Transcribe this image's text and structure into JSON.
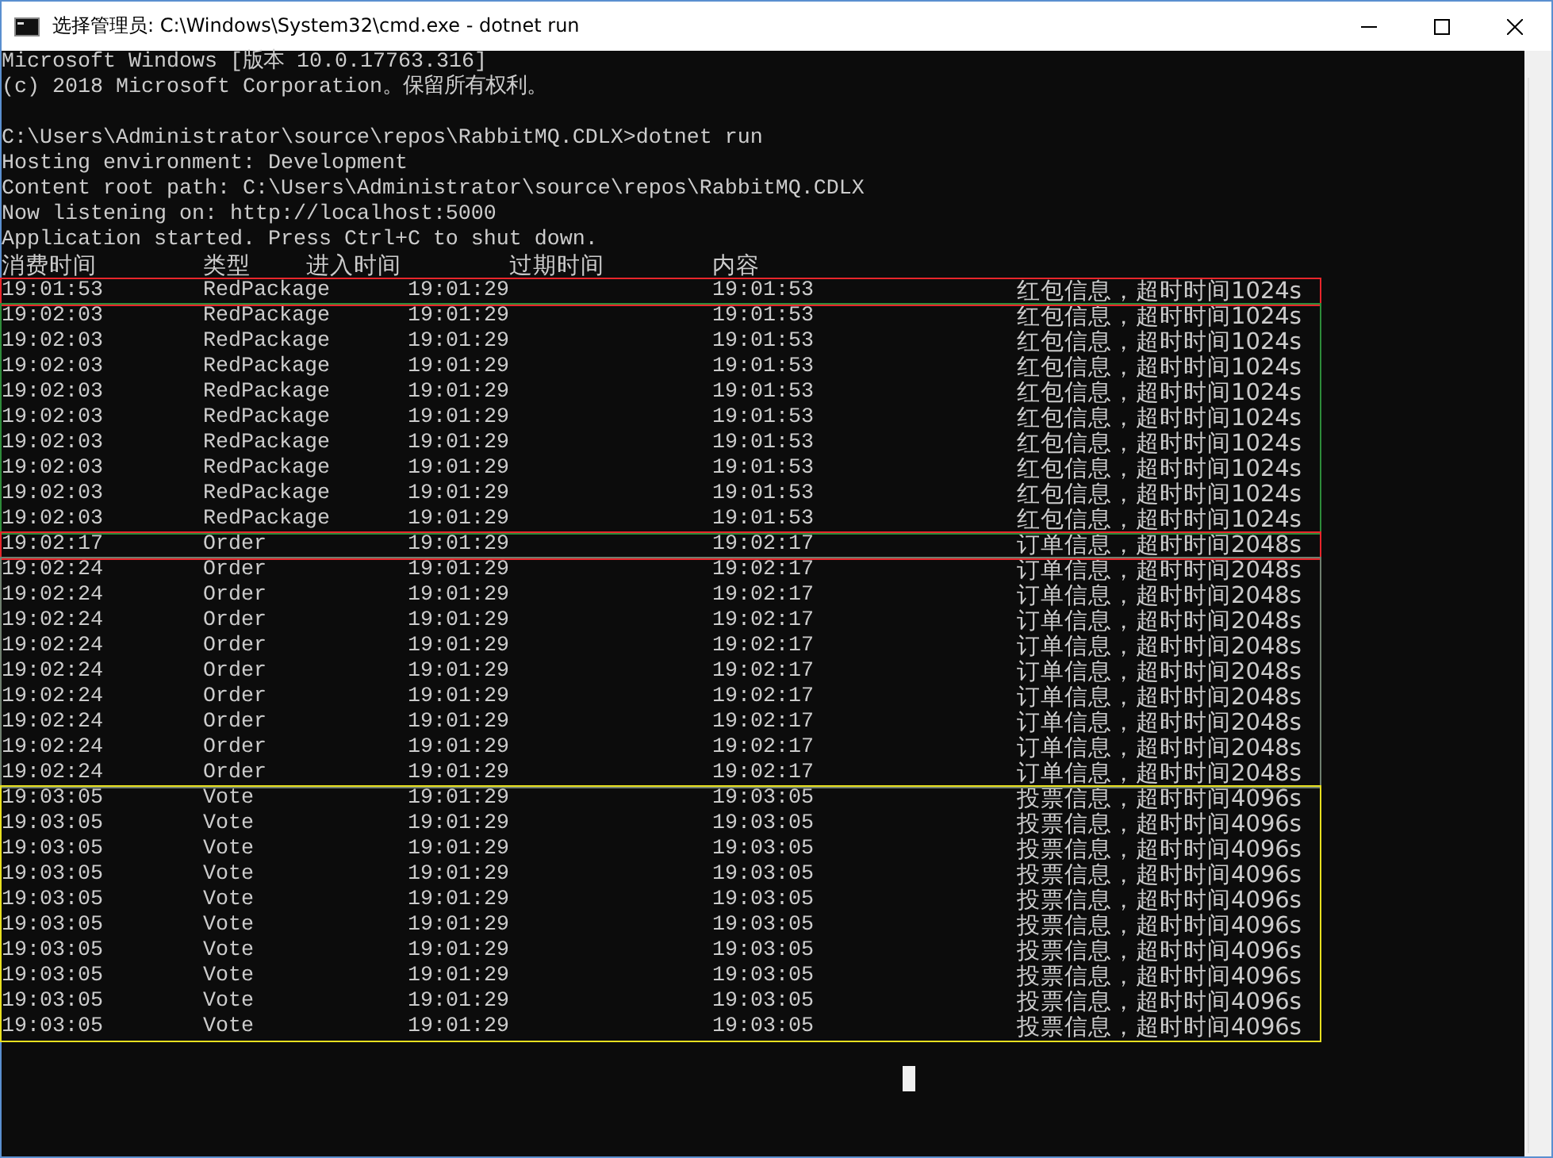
{
  "window": {
    "title": "选择管理员: C:\\Windows\\System32\\cmd.exe - dotnet  run"
  },
  "console": {
    "blocks": [
      [
        "Microsoft Windows [版本 10.0.17763.316]",
        "(c) 2018 Microsoft Corporation。保留所有权利。"
      ],
      [
        "C:\\Users\\Administrator\\source\\repos\\RabbitMQ.CDLX>dotnet run",
        "Hosting environment: Development",
        "Content root path: C:\\Users\\Administrator\\source\\repos\\RabbitMQ.CDLX",
        "Now listening on: http://localhost:5000",
        "Application started. Press Ctrl+C to shut down."
      ]
    ],
    "header": [
      "消费时间",
      "类型",
      "进入时间",
      "过期时间",
      "内容"
    ],
    "groups": [
      {
        "color": "#e8262b",
        "rows": [
          [
            "19:01:53",
            "RedPackage",
            "19:01:29",
            "19:01:53",
            "红包信息，超时时间1024s"
          ]
        ]
      },
      {
        "color": "#2e8b3a",
        "rows": [
          [
            "19:02:03",
            "RedPackage",
            "19:01:29",
            "19:01:53",
            "红包信息，超时时间1024s"
          ],
          [
            "19:02:03",
            "RedPackage",
            "19:01:29",
            "19:01:53",
            "红包信息，超时时间1024s"
          ],
          [
            "19:02:03",
            "RedPackage",
            "19:01:29",
            "19:01:53",
            "红包信息，超时时间1024s"
          ],
          [
            "19:02:03",
            "RedPackage",
            "19:01:29",
            "19:01:53",
            "红包信息，超时时间1024s"
          ],
          [
            "19:02:03",
            "RedPackage",
            "19:01:29",
            "19:01:53",
            "红包信息，超时时间1024s"
          ],
          [
            "19:02:03",
            "RedPackage",
            "19:01:29",
            "19:01:53",
            "红包信息，超时时间1024s"
          ],
          [
            "19:02:03",
            "RedPackage",
            "19:01:29",
            "19:01:53",
            "红包信息，超时时间1024s"
          ],
          [
            "19:02:03",
            "RedPackage",
            "19:01:29",
            "19:01:53",
            "红包信息，超时时间1024s"
          ],
          [
            "19:02:03",
            "RedPackage",
            "19:01:29",
            "19:01:53",
            "红包信息，超时时间1024s"
          ]
        ]
      },
      {
        "color": "#e8262b",
        "rows": [
          [
            "19:02:17",
            "Order",
            "19:01:29",
            "19:02:17",
            "订单信息，超时时间2048s"
          ]
        ]
      },
      {
        "color": "#6f7f6f",
        "rows": [
          [
            "19:02:24",
            "Order",
            "19:01:29",
            "19:02:17",
            "订单信息，超时时间2048s"
          ],
          [
            "19:02:24",
            "Order",
            "19:01:29",
            "19:02:17",
            "订单信息，超时时间2048s"
          ],
          [
            "19:02:24",
            "Order",
            "19:01:29",
            "19:02:17",
            "订单信息，超时时间2048s"
          ],
          [
            "19:02:24",
            "Order",
            "19:01:29",
            "19:02:17",
            "订单信息，超时时间2048s"
          ],
          [
            "19:02:24",
            "Order",
            "19:01:29",
            "19:02:17",
            "订单信息，超时时间2048s"
          ],
          [
            "19:02:24",
            "Order",
            "19:01:29",
            "19:02:17",
            "订单信息，超时时间2048s"
          ],
          [
            "19:02:24",
            "Order",
            "19:01:29",
            "19:02:17",
            "订单信息，超时时间2048s"
          ],
          [
            "19:02:24",
            "Order",
            "19:01:29",
            "19:02:17",
            "订单信息，超时时间2048s"
          ],
          [
            "19:02:24",
            "Order",
            "19:01:29",
            "19:02:17",
            "订单信息，超时时间2048s"
          ]
        ]
      },
      {
        "color": "#e8e020",
        "rows": [
          [
            "19:03:05",
            "Vote",
            "19:01:29",
            "19:03:05",
            "投票信息，超时时间4096s"
          ],
          [
            "19:03:05",
            "Vote",
            "19:01:29",
            "19:03:05",
            "投票信息，超时时间4096s"
          ],
          [
            "19:03:05",
            "Vote",
            "19:01:29",
            "19:03:05",
            "投票信息，超时时间4096s"
          ],
          [
            "19:03:05",
            "Vote",
            "19:01:29",
            "19:03:05",
            "投票信息，超时时间4096s"
          ],
          [
            "19:03:05",
            "Vote",
            "19:01:29",
            "19:03:05",
            "投票信息，超时时间4096s"
          ],
          [
            "19:03:05",
            "Vote",
            "19:01:29",
            "19:03:05",
            "投票信息，超时时间4096s"
          ],
          [
            "19:03:05",
            "Vote",
            "19:01:29",
            "19:03:05",
            "投票信息，超时时间4096s"
          ],
          [
            "19:03:05",
            "Vote",
            "19:01:29",
            "19:03:05",
            "投票信息，超时时间4096s"
          ],
          [
            "19:03:05",
            "Vote",
            "19:01:29",
            "19:03:05",
            "投票信息，超时时间4096s"
          ],
          [
            "19:03:05",
            "Vote",
            "19:01:29",
            "19:03:05",
            "投票信息，超时时间4096s"
          ]
        ]
      }
    ]
  }
}
